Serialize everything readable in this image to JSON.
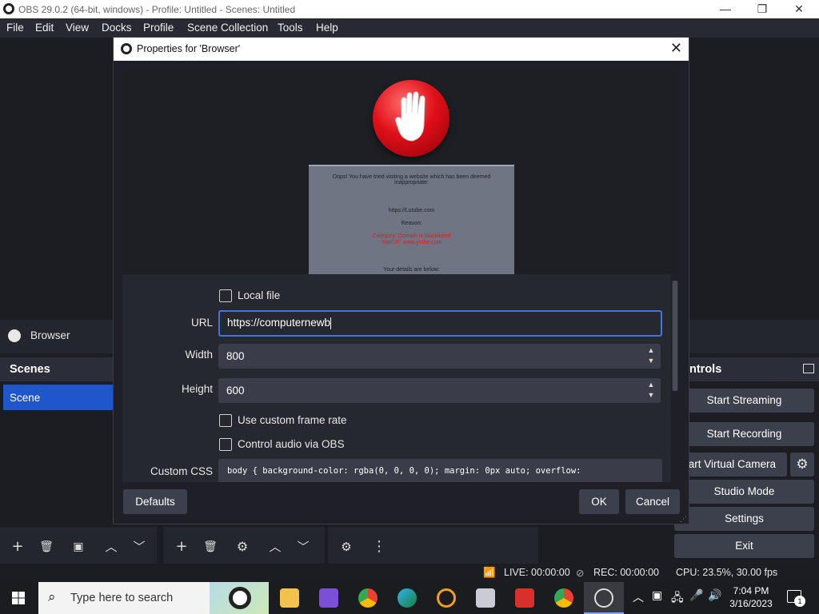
{
  "window": {
    "title": "OBS 29.0.2 (64-bit, windows) - Profile: Untitled - Scenes: Untitled",
    "minimize": "—",
    "maximize": "❐",
    "close": "✕"
  },
  "menu": [
    "File",
    "Edit",
    "View",
    "Docks",
    "Profile",
    "Scene Collection",
    "Tools",
    "Help"
  ],
  "sources": {
    "item_label": "Browser"
  },
  "scenes": {
    "header": "Scenes",
    "items": [
      "Scene"
    ]
  },
  "controls": {
    "header": "ntrols",
    "buttons": [
      "Start Streaming",
      "Start Recording",
      "tart Virtual Camera",
      "Studio Mode",
      "Settings",
      "Exit"
    ]
  },
  "status": {
    "live": "LIVE: 00:00:00",
    "rec": "REC: 00:00:00",
    "cpu": "CPU: 23.5%, 30.00 fps"
  },
  "dialog": {
    "title": "Properties for 'Browser'",
    "close": "✕",
    "preview": {
      "message": "Oops! You have tried visiting a website which has been deemed inappropriate:",
      "url_line": "https://Lutube.com",
      "reason_label": "Reason:",
      "reason_red_1": "Category: Domain is blacklisted",
      "reason_red_2": "Site/Url: www.ytube.com",
      "details": "Your details are below:"
    },
    "local_file_label": "Local file",
    "url_label": "URL",
    "url_value": "https://computernewb",
    "width_label": "Width",
    "width_value": "800",
    "height_label": "Height",
    "height_value": "600",
    "custom_fps_label": "Use custom frame rate",
    "control_audio_label": "Control audio via OBS",
    "custom_css_label": "Custom CSS",
    "custom_css_value": "body { background-color: rgba(0, 0, 0, 0); margin: 0px auto; overflow:",
    "defaults_button": "Defaults",
    "ok_button": "OK",
    "cancel_button": "Cancel"
  },
  "taskbar": {
    "search_placeholder": "Type here to search",
    "time": "7:04 PM",
    "date": "3/16/2023",
    "notification_count": "1"
  },
  "colors": {
    "accent_blue": "#1f56c9",
    "focus_border": "#3f75e0",
    "stop_red": "#e0101a"
  }
}
